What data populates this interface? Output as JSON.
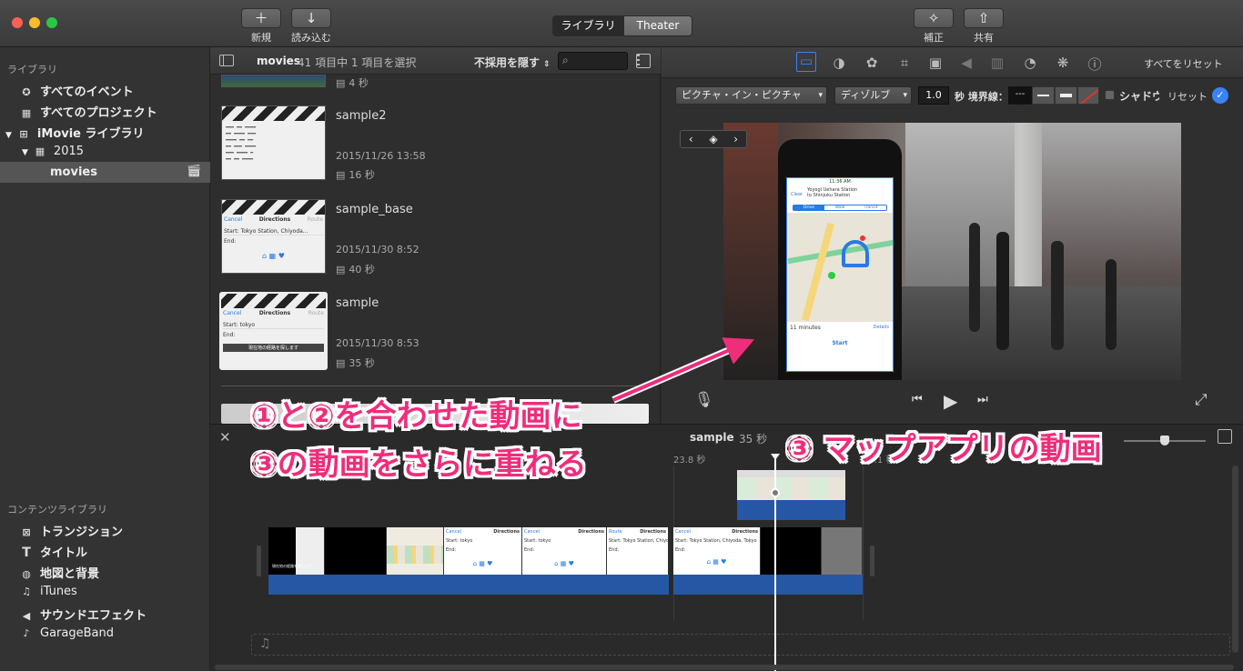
{
  "toolbar": {
    "new_label": "新規",
    "import_label": "読み込む",
    "seg_library": "ライブラリ",
    "seg_theater": "Theater",
    "adjust_label": "補正",
    "share_label": "共有"
  },
  "sidebar": {
    "library_header": "ライブラリ",
    "all_events": "すべてのイベント",
    "all_projects": "すべてのプロジェクト",
    "imovie_library": "iMovie ライブラリ",
    "year": "2015",
    "movies": "movies",
    "content_header": "コンテンツライブラリ",
    "content_items": [
      "トランジション",
      "タイトル",
      "地図と背景",
      "iTunes",
      "サウンドエフェクト",
      "GarageBand"
    ]
  },
  "browser": {
    "title": "movies",
    "count_text": "41 項目中 1 項目を選択",
    "filter_label": "不採用を隠す",
    "search_placeholder": "",
    "top_partial_duration": "4 秒",
    "clips": [
      {
        "name": "sample2",
        "date": "2015/11/26 13:58",
        "duration": "16 秒"
      },
      {
        "name": "sample_base",
        "date": "2015/11/30 8:52",
        "duration": "40 秒"
      },
      {
        "name": "sample",
        "date": "2015/11/30 8:53",
        "duration": "35 秒"
      }
    ]
  },
  "viewer": {
    "reset_all": "すべてをリセット",
    "pip_label": "ピクチャ・イン・ピクチャ",
    "dissolve_label": "ディゾルブ",
    "duration_value": "1.0",
    "border_label": "秒 境界線：",
    "border_none": "---",
    "shadow_label": "シャドウ",
    "reset_label": "リセット",
    "phone": {
      "time": "11:36 AM",
      "clear": "Clear",
      "route_from": "Yoyogi Uehara Station",
      "route_to": "to Shinjuku Station",
      "modes": [
        "Drive",
        "Walk",
        "Transit"
      ],
      "eta": "11 minutes",
      "details": "Details",
      "start": "Start"
    }
  },
  "timeline": {
    "project_name": "sample",
    "project_duration": "35 秒",
    "time_marker_1": "23.8 秒",
    "time_marker_2": "35.1 秒",
    "frame_cancel": "Cancel",
    "frame_directions": "Directions",
    "frame_route": "Route",
    "frame_start": "Start:",
    "frame_end": "End:",
    "frame_tokyo": "tokyo",
    "frame_tokyo_station": "Tokyo Station, Chiyoda, Tokyo",
    "frame_subtitle": "現在地の経路を探します"
  },
  "annotations": {
    "text1": "①と②を合わせた動画に",
    "text2": "③の動画をさらに重ねる",
    "text3": "③ マップアプリの動画"
  },
  "colors": {
    "accent_pink": "#ee2e7a",
    "clip_blue": "#2557a4",
    "selection": "#555555"
  }
}
